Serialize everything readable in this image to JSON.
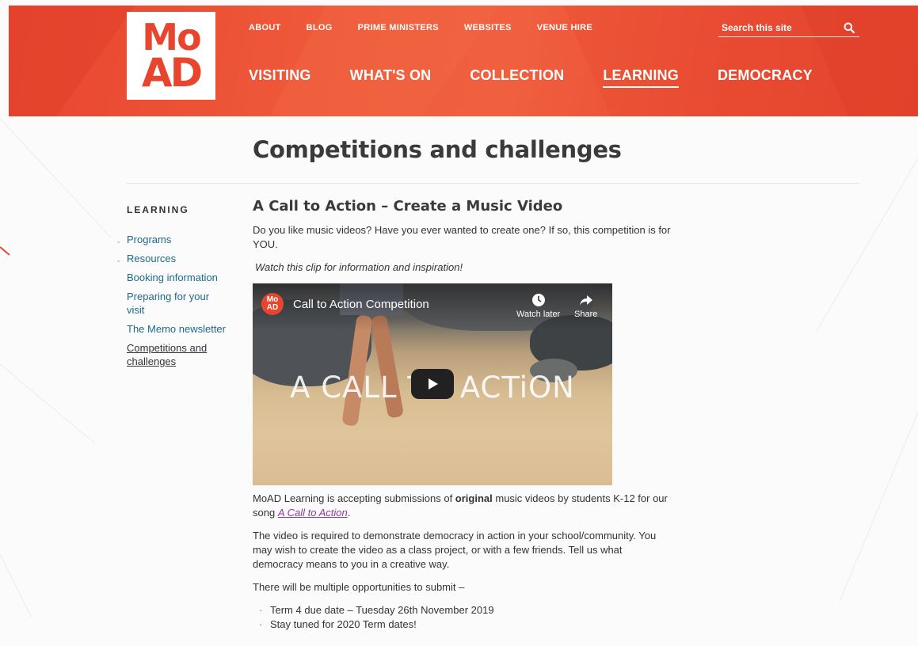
{
  "logo": {
    "line1": "Mo",
    "line2": "AD"
  },
  "utility_nav": [
    "ABOUT",
    "BLOG",
    "PRIME MINISTERS",
    "WEBSITES",
    "VENUE HIRE"
  ],
  "search": {
    "placeholder": "Search this site"
  },
  "main_nav": [
    {
      "label": "VISITING",
      "active": false
    },
    {
      "label": "WHAT'S ON",
      "active": false
    },
    {
      "label": "COLLECTION",
      "active": false
    },
    {
      "label": "LEARNING",
      "active": true
    },
    {
      "label": "DEMOCRACY",
      "active": false
    }
  ],
  "page_title": "Competitions and challenges",
  "sidebar": {
    "heading": "LEARNING",
    "items": [
      {
        "label": "Programs",
        "expandable": true
      },
      {
        "label": "Resources",
        "expandable": true
      },
      {
        "label": "Booking information",
        "expandable": false
      },
      {
        "label": "Preparing for your visit",
        "expandable": false
      },
      {
        "label": "The Memo newsletter",
        "expandable": false
      },
      {
        "label": "Competitions and challenges",
        "expandable": false,
        "current": true
      }
    ]
  },
  "article": {
    "heading": "A Call to Action – Create a Music Video",
    "intro": " Do you like music videos?  Have you ever wanted to create one?  If so, this competition is for YOU.",
    "watch_note": "Watch this clip for information and inspiration!",
    "video": {
      "channel_logo": {
        "line1": "Mo",
        "line2": "AD"
      },
      "title": "Call to Action Competition",
      "watch_later_label": "Watch later",
      "share_label": "Share",
      "overlay_text": "A CALL TO ACTiON"
    },
    "submissions": {
      "before": "MoAD Learning is accepting submissions of ",
      "bold": "original",
      "middle": " music videos by students K-12 for our song ",
      "link": "A Call to Action",
      "after": "."
    },
    "requirement": "The video is required to demonstrate democracy in action in your school/community. You may wish to create the video as a class project, or with a few friends.  Tell us what democracy means to you in a creative way.",
    "opportunities": "There will be multiple opportunities to submit –",
    "dates": [
      "Term 4 due date – Tuesday 26th November 2019",
      "Stay tuned for 2020 Term dates!"
    ]
  }
}
